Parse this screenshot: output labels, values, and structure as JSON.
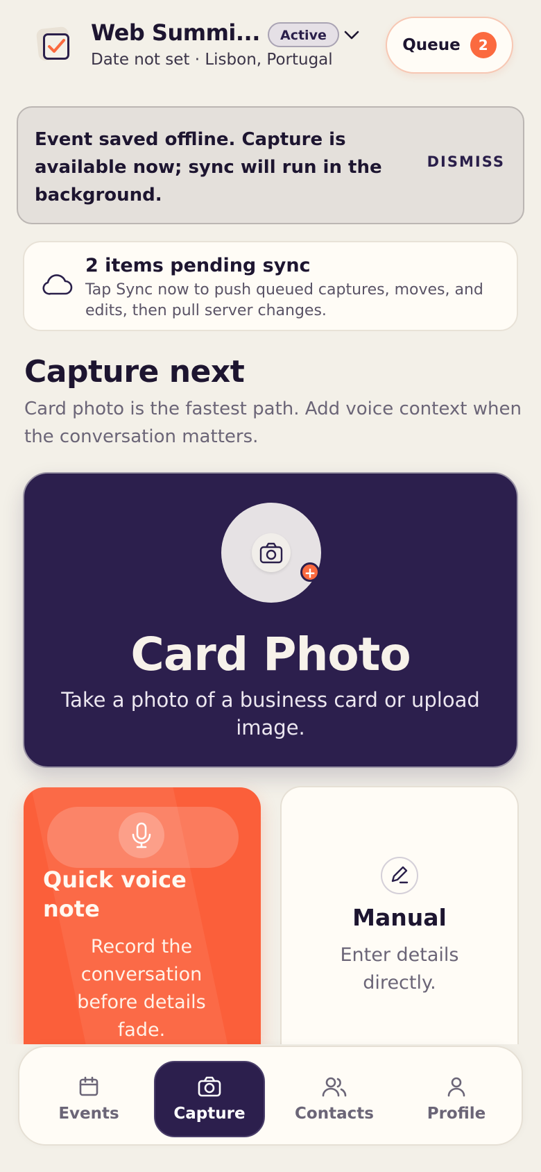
{
  "header": {
    "event_title": "Web Summi...",
    "status": "Active",
    "event_subtitle": "Date not set · Lisbon, Portugal",
    "queue_label": "Queue",
    "queue_count": "2"
  },
  "offline_banner": {
    "message": "Event saved offline. Capture is available now; sync will run in the background.",
    "dismiss_label": "DISMISS"
  },
  "sync": {
    "title": "2 items pending sync",
    "description": "Tap Sync now to push queued captures, moves, and edits, then pull server changes."
  },
  "capture": {
    "heading": "Capture next",
    "subheading": "Card photo is the fastest path. Add voice context when the conversation matters.",
    "card_photo": {
      "title": "Card Photo",
      "description": "Take a photo of a business card or upload image."
    },
    "voice_note": {
      "title": "Quick voice note",
      "description": "Record the conversation before details fade."
    },
    "manual": {
      "title": "Manual",
      "description": "Enter details directly."
    }
  },
  "nav": {
    "items": [
      {
        "label": "Events",
        "icon": "calendar-icon"
      },
      {
        "label": "Capture",
        "icon": "camera-icon",
        "active": true
      },
      {
        "label": "Contacts",
        "icon": "users-icon"
      },
      {
        "label": "Profile",
        "icon": "user-icon"
      }
    ]
  },
  "colors": {
    "background": "#f3f0e8",
    "primary_dark": "#2c1f4d",
    "accent_orange": "#fb5f3a",
    "card": "#fffcf6"
  }
}
